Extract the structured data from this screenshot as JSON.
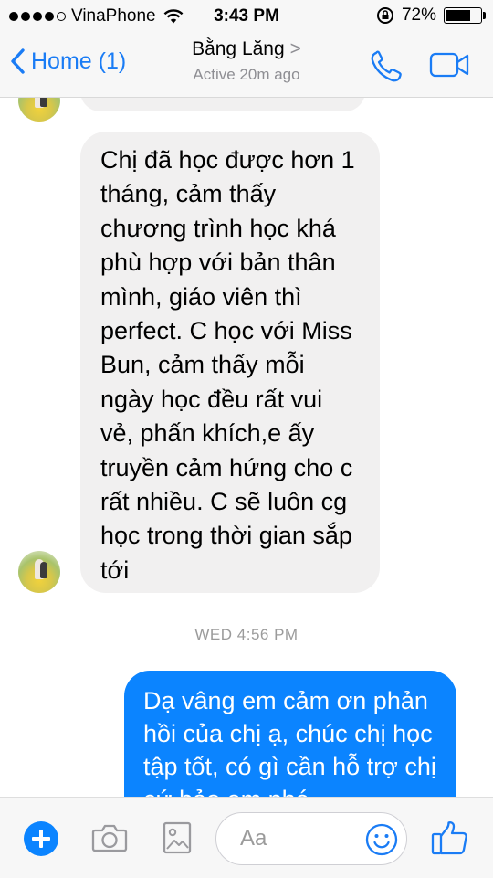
{
  "status_bar": {
    "carrier": "VinaPhone",
    "time": "3:43 PM",
    "battery": "72%",
    "battery_level": 0.72,
    "signal_dots": 4
  },
  "nav": {
    "back_label": "Home (1)",
    "contact_name": "Bằng Lăng",
    "chevron": ">",
    "status": "Active 20m ago",
    "icons": [
      "chevron-left-icon",
      "phone-icon",
      "video-camera-icon"
    ]
  },
  "messages": {
    "incoming": "Chị đã học được hơn 1 tháng, cảm thấy chương trình học khá phù hợp với bản thân mình, giáo viên thì perfect. C học với Miss Bun, cảm thấy mỗi ngày học đều rất vui vẻ, phấn khích,e ấy truyền cảm hứng cho c rất nhiều. C sẽ luôn cg học trong thời gian sắp tới",
    "timestamp": "WED 4:56 PM",
    "outgoing": "Dạ vâng em cảm ơn phản hồi của chị ạ, chúc chị học tập tốt, có gì cần hỗ trợ chị cứ bảo em nhé"
  },
  "composer": {
    "placeholder": "Aa",
    "icons": [
      "plus-icon",
      "camera-icon",
      "image-icon",
      "emoji-icon",
      "thumbs-up-icon"
    ]
  },
  "colors": {
    "accent": "#1a7cf5",
    "outgoing_bubble": "#0b84ff",
    "incoming_bubble": "#f1f0f0",
    "bar_background": "#f7f7f7"
  }
}
